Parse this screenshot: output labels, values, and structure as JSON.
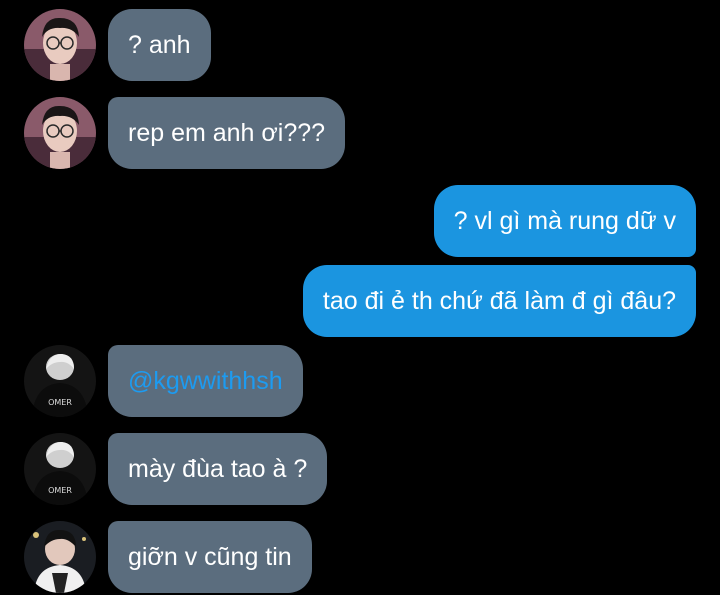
{
  "messages": [
    {
      "direction": "incoming",
      "text": "? anh",
      "avatar": "avatar-a"
    },
    {
      "direction": "incoming",
      "text": "rep em anh ơi???",
      "avatar": "avatar-a"
    },
    {
      "direction": "outgoing",
      "text": "? vl gì mà rung dữ v"
    },
    {
      "direction": "outgoing",
      "text": "tao đi ẻ th chứ đã làm đ gì đâu?"
    },
    {
      "direction": "incoming",
      "text": "@kgwwithhsh",
      "avatar": "avatar-b",
      "is_mention": true
    },
    {
      "direction": "incoming",
      "text": "mày đùa tao à ?",
      "avatar": "avatar-b"
    },
    {
      "direction": "incoming",
      "text": "giỡn v cũng tin",
      "avatar": "avatar-c"
    }
  ],
  "avatar_text": {
    "jersey_label": "OMER"
  },
  "colors": {
    "background": "#000000",
    "incoming_bubble": "#5b6d7e",
    "outgoing_bubble": "#1b95e0",
    "mention": "#1d9bf0",
    "text": "#ffffff"
  }
}
